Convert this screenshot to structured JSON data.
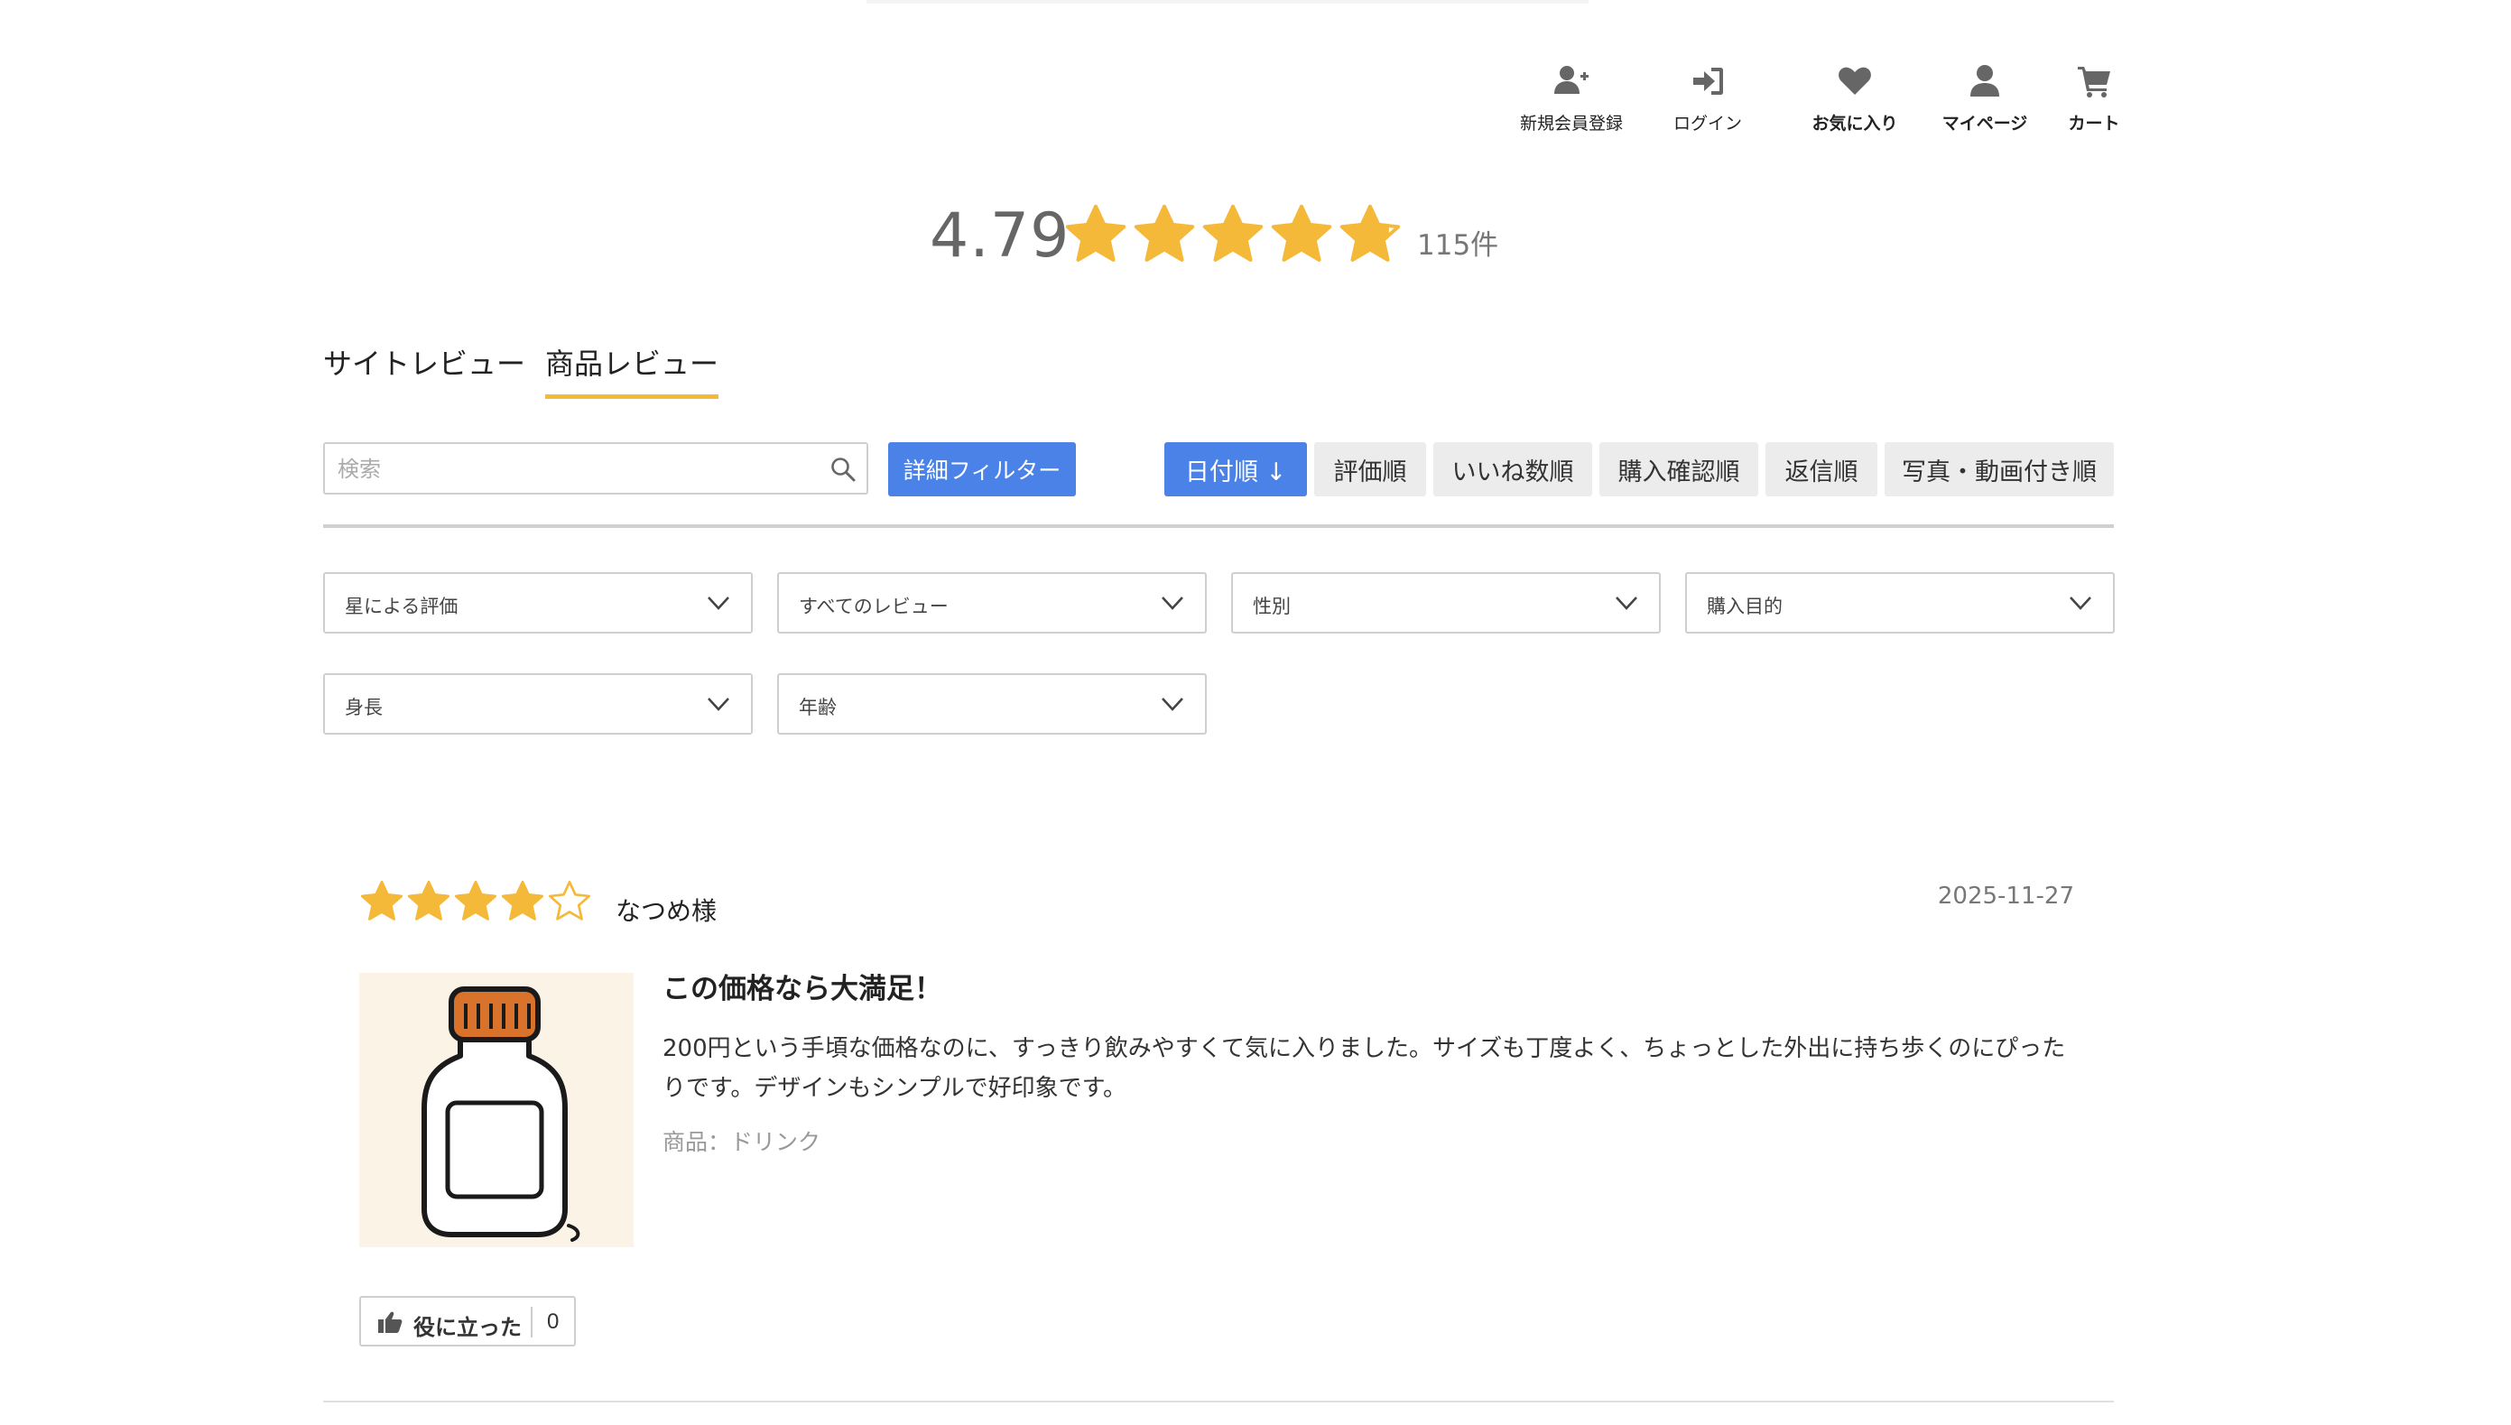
{
  "header": {
    "nav": [
      {
        "id": "register",
        "label": "新規会員登録",
        "icon": "user-plus-icon"
      },
      {
        "id": "login",
        "label": "ログイン",
        "icon": "sign-in-icon"
      },
      {
        "id": "favorites",
        "label": "お気に入り",
        "icon": "heart-icon"
      },
      {
        "id": "mypage",
        "label": "マイページ",
        "icon": "user-icon"
      },
      {
        "id": "cart",
        "label": "カート",
        "icon": "cart-icon"
      }
    ]
  },
  "summary": {
    "score": "4.79",
    "rating": 4.79,
    "max_rating": 5,
    "count": "115件"
  },
  "tabs": [
    {
      "label": "サイトレビュー",
      "active": false
    },
    {
      "label": "商品レビュー",
      "active": true
    }
  ],
  "search": {
    "placeholder": "検索",
    "value": ""
  },
  "filter_button": {
    "label": "詳細フィルター"
  },
  "sort_buttons": [
    {
      "label": "日付順 ↓",
      "active": true
    },
    {
      "label": "評価順",
      "active": false
    },
    {
      "label": "いいね数順",
      "active": false
    },
    {
      "label": "購入確認順",
      "active": false
    },
    {
      "label": "返信順",
      "active": false
    },
    {
      "label": "写真・動画付き順",
      "active": false
    }
  ],
  "dropdowns": [
    {
      "label": "星による評価"
    },
    {
      "label": "すべてのレビュー"
    },
    {
      "label": "性別"
    },
    {
      "label": "購入目的"
    },
    {
      "label": "身長"
    },
    {
      "label": "年齢"
    }
  ],
  "review": {
    "rating": 4,
    "max_rating": 5,
    "author": "なつめ様",
    "date": "2025-11-27",
    "title": "この価格なら大満足！",
    "body": "200円という手頃な価格なのに、すっきり飲みやすくて気に入りました。サイズも丁度よく、ちょっとした外出に持ち歩くのにぴったりです。デザインもシンプルで好印象です。",
    "product": "商品：ドリンク",
    "helpful_label": "役に立った",
    "helpful_count": "0"
  },
  "colors": {
    "star": "#f5b93a",
    "accent_blue": "#4a82e8",
    "tab_underline": "#f5b93a",
    "button_gray": "#ececec"
  }
}
